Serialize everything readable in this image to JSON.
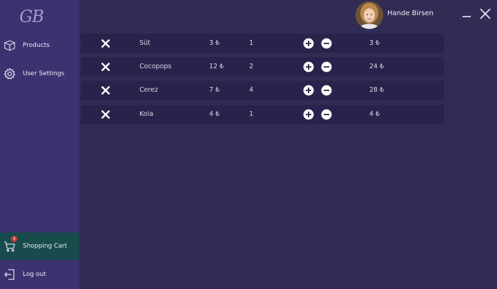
{
  "app": {
    "logo_text": "GB"
  },
  "user": {
    "name": "Hande Birsen"
  },
  "sidebar": {
    "items": [
      {
        "label": "Products",
        "icon": "box-icon"
      },
      {
        "label": "User Settings",
        "icon": "gear-icon"
      },
      {
        "label": "Shopping Cart",
        "icon": "cart-icon",
        "badge": "3",
        "active": true
      },
      {
        "label": "Log out",
        "icon": "logout-icon"
      }
    ]
  },
  "colors": {
    "background": "#302c54",
    "sidebar": "#3b3270",
    "row": "#27234a",
    "active_nav": "#184c4c",
    "badge": "#c43a3a"
  },
  "cart": {
    "rows": [
      {
        "name": "Süt",
        "price": "3 ₺",
        "qty": "1",
        "total": "3 ₺"
      },
      {
        "name": "Cocopops",
        "price": "12 ₺",
        "qty": "2",
        "total": "24 ₺"
      },
      {
        "name": "Cerez",
        "price": "7 ₺",
        "qty": "4",
        "total": "28 ₺"
      },
      {
        "name": "Kola",
        "price": "4 ₺",
        "qty": "1",
        "total": "4 ₺"
      }
    ]
  }
}
